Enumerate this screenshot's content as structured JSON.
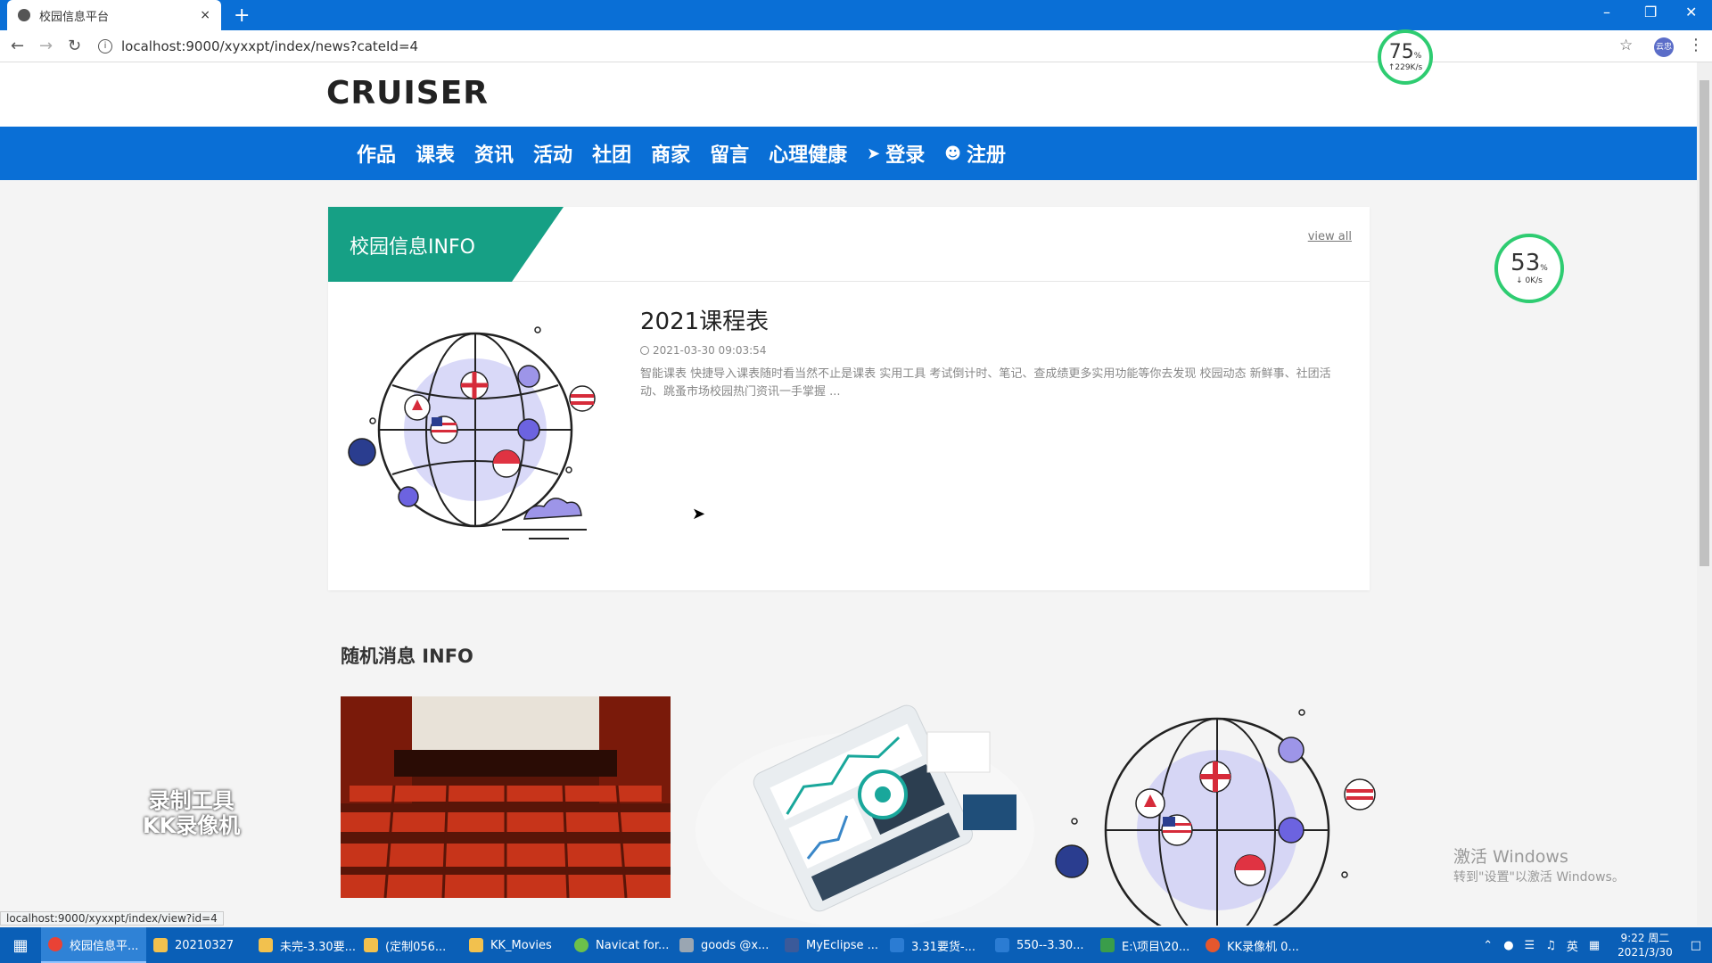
{
  "browser": {
    "tab_title": "校园信息平台",
    "tab_close": "×",
    "new_tab": "+",
    "url": "localhost:9000/xyxxpt/index/news?cateId=4",
    "status_url": "localhost:9000/xyxxpt/index/view?id=4",
    "profile_label": "云忠"
  },
  "site": {
    "brand": "CRUISER",
    "nav": [
      {
        "label": "作品"
      },
      {
        "label": "课表"
      },
      {
        "label": "资讯"
      },
      {
        "label": "活动"
      },
      {
        "label": "社团"
      },
      {
        "label": "商家"
      },
      {
        "label": "留言"
      },
      {
        "label": "心理健康"
      },
      {
        "label": "登录",
        "icon": "login-icon"
      },
      {
        "label": "注册",
        "icon": "user-plus-icon"
      }
    ]
  },
  "info_section": {
    "heading": "校园信息INFO",
    "view_all": "view all",
    "news": {
      "title": "2021课程表",
      "date": "2021-03-30 09:03:54",
      "desc": "智能课表 快捷导入课表随时看当然不止是课表 实用工具 考试倒计时、笔记、查成绩更多实用功能等你去发现 校园动态 新鲜事、社团活动、跳蚤市场校园热门资讯一手掌握 ..."
    }
  },
  "random_section": {
    "heading": "随机消息 INFO"
  },
  "overlays": {
    "gauge1": {
      "pct": "75",
      "unit": "%",
      "speed": "↑229K/s"
    },
    "gauge2": {
      "pct": "53",
      "unit": "%",
      "speed": "↓ 0K/s"
    },
    "recorder_line1": "录制工具",
    "recorder_line2": "KK录像机",
    "activate_line1": "激活 Windows",
    "activate_line2": "转到\"设置\"以激活 Windows。"
  },
  "taskbar": {
    "items": [
      {
        "label": "校园信息平...",
        "color": "#e94235"
      },
      {
        "label": "20210327",
        "color": "#f2c14e"
      },
      {
        "label": "未完-3.30要...",
        "color": "#f2c14e"
      },
      {
        "label": "(定制056...",
        "color": "#f2c14e"
      },
      {
        "label": "KK_Movies",
        "color": "#f2c14e"
      },
      {
        "label": "Navicat for...",
        "color": "#6cc04a"
      },
      {
        "label": "goods @x...",
        "color": "#9aa6b2"
      },
      {
        "label": "MyEclipse ...",
        "color": "#3b5a9a"
      },
      {
        "label": "3.31要货-...",
        "color": "#2b7cd3"
      },
      {
        "label": "550--3.30...",
        "color": "#2b7cd3"
      },
      {
        "label": "E:\\项目\\20...",
        "color": "#3a9d4a"
      },
      {
        "label": "KK录像机 0...",
        "color": "#e4572e"
      }
    ],
    "ime": "英",
    "time": "9:22 周二",
    "date": "2021/3/30"
  }
}
